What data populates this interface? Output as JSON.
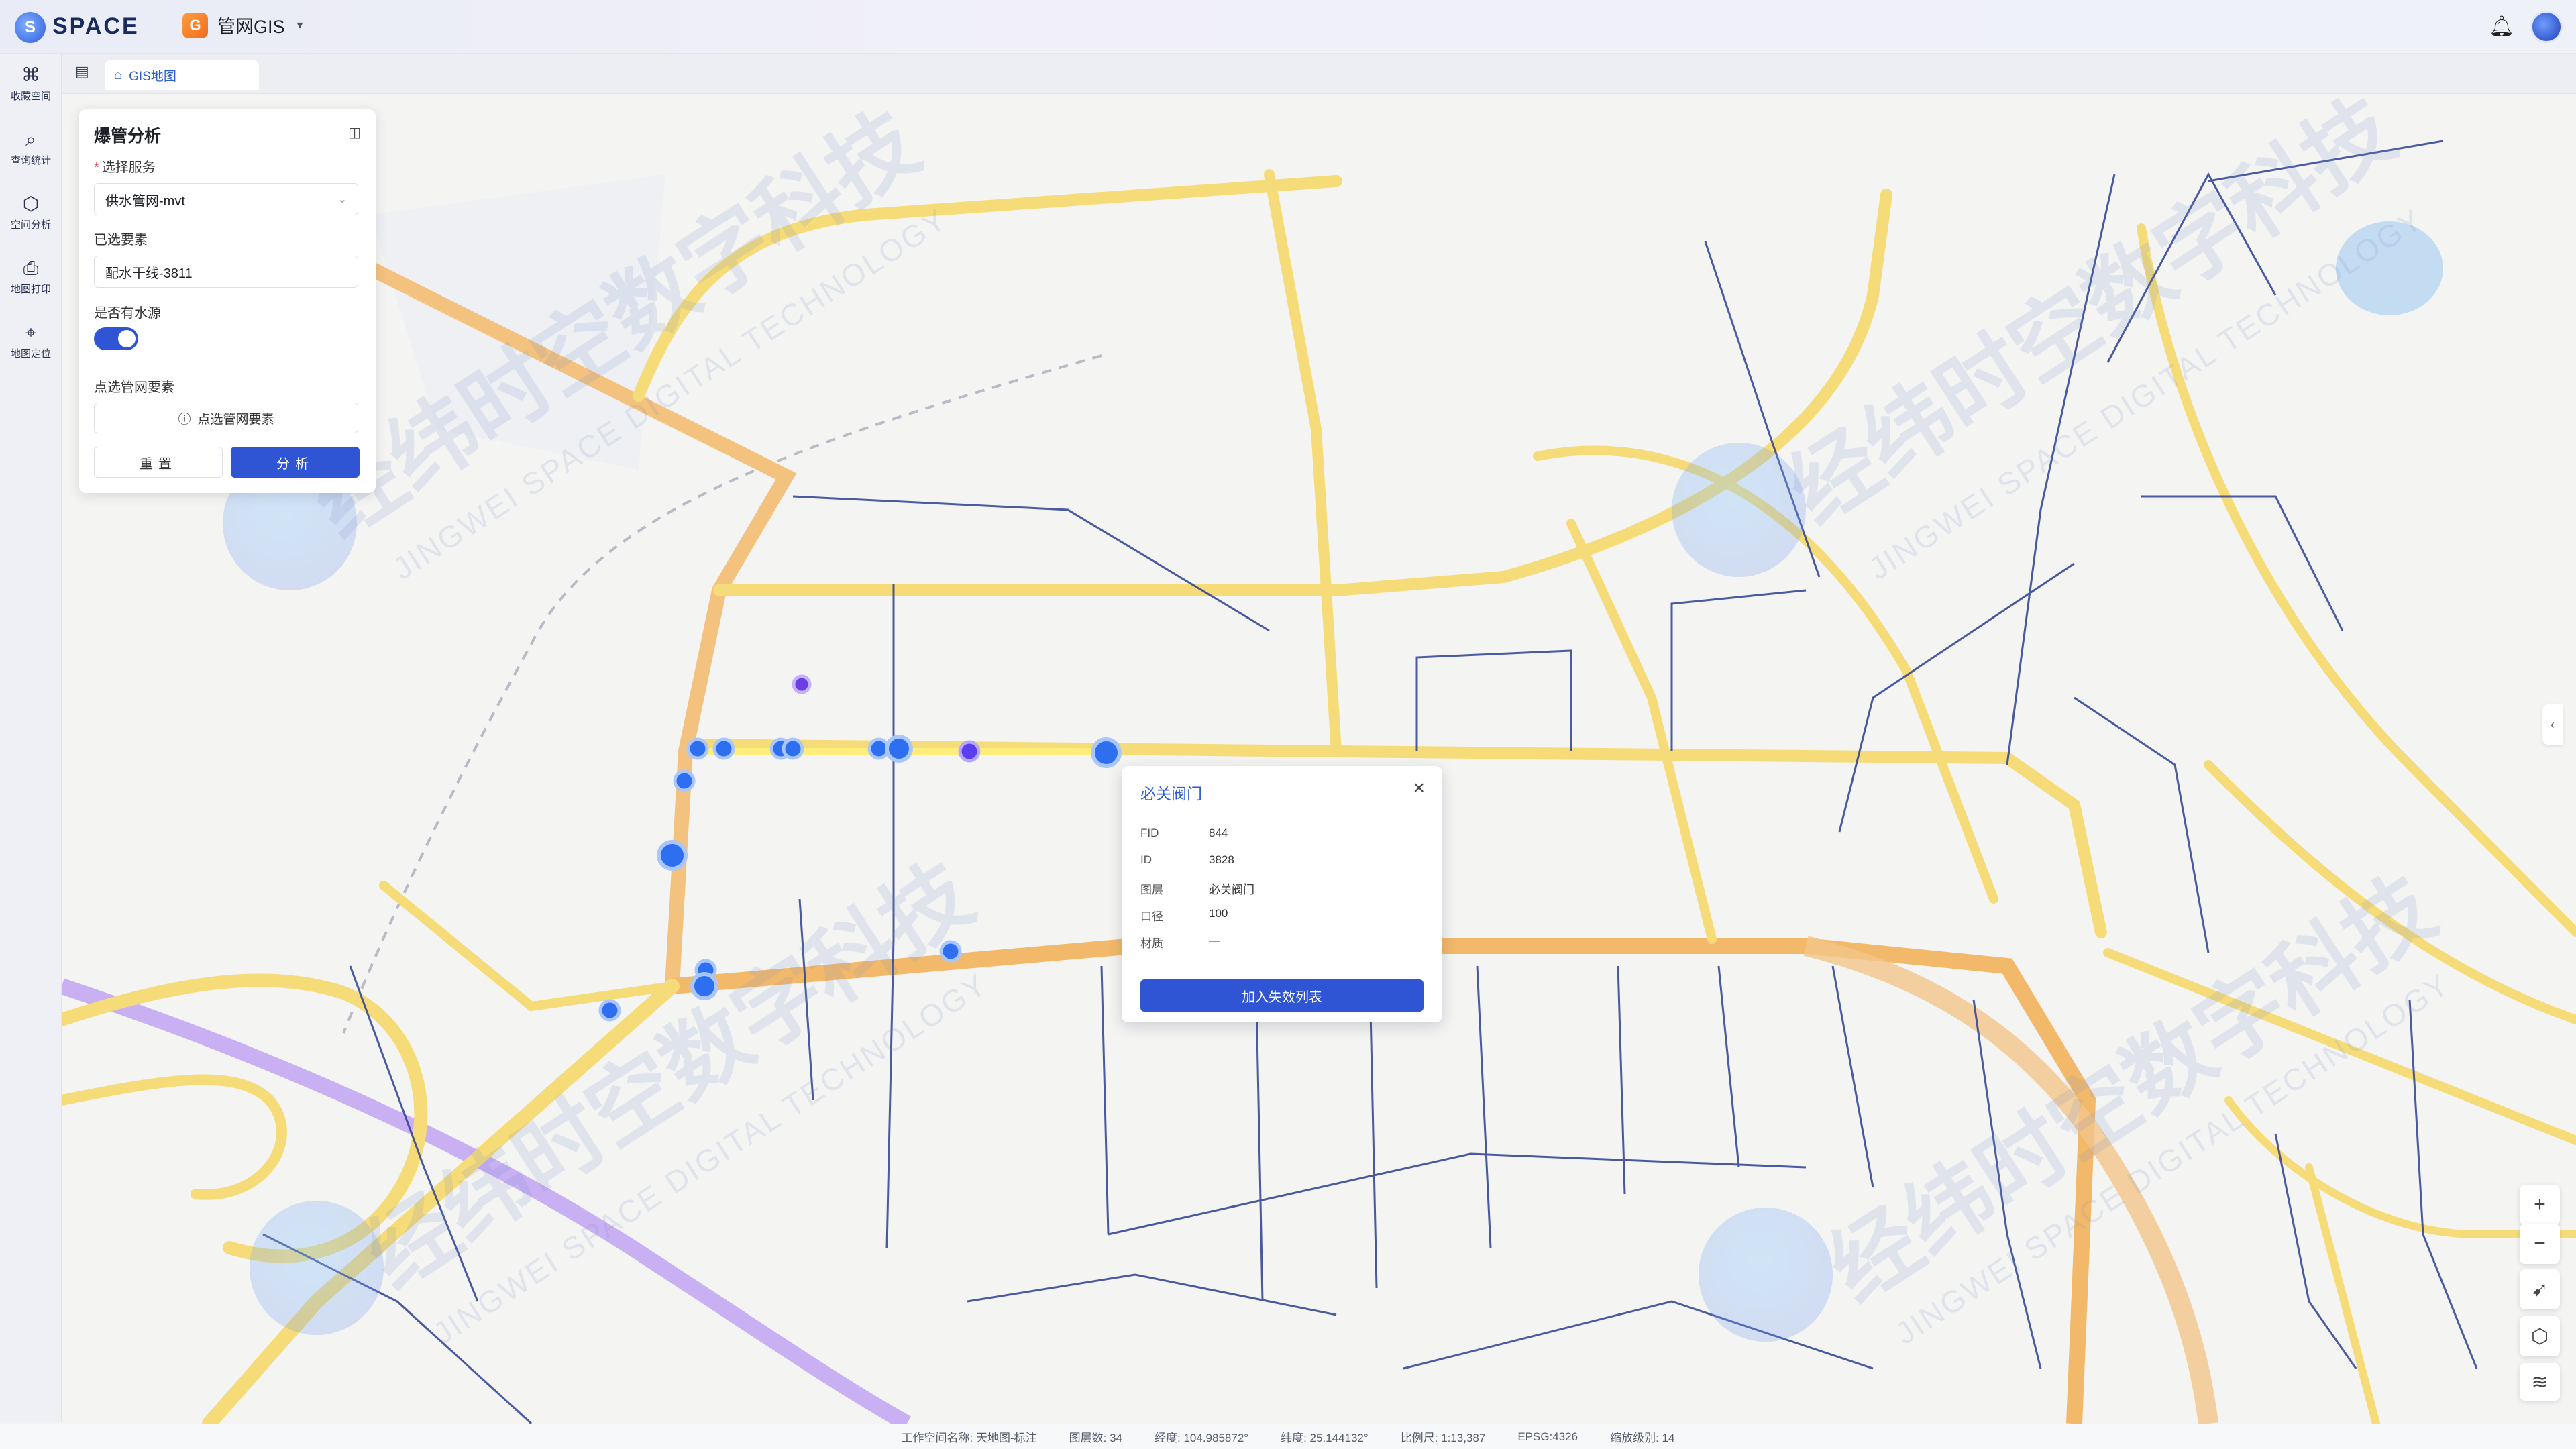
{
  "topbar": {
    "brand": "SPACE",
    "logo_glyph": "S",
    "app_name": "管网GIS",
    "app_glyph": "G"
  },
  "sidenav": [
    {
      "icon": "map-collection-icon",
      "label": "收藏空间"
    },
    {
      "icon": "query-stats-icon",
      "label": "查询统计"
    },
    {
      "icon": "spatial-analysis-icon",
      "label": "空间分析"
    },
    {
      "icon": "print-icon",
      "label": "地图打印"
    },
    {
      "icon": "location-icon",
      "label": "地图定位"
    }
  ],
  "tabs": [
    {
      "label": "GIS地图"
    }
  ],
  "panel": {
    "title": "爆管分析",
    "service_label": "选择服务",
    "service_value": "供水管网-mvt",
    "selected_label": "已选要素",
    "selected_value": "配水干线-3811",
    "water_source_label": "是否有水源",
    "water_source_on": true,
    "pick_label": "点选管网要素",
    "pick_button": "点选管网要素",
    "reset_button": "重置",
    "analyze_button": "分析"
  },
  "popup": {
    "title": "必关阀门",
    "rows": [
      {
        "key": "FID",
        "value": "844"
      },
      {
        "key": "ID",
        "value": "3828"
      },
      {
        "key": "图层",
        "value": "必关阀门"
      },
      {
        "key": "口径",
        "value": "100"
      },
      {
        "key": "材质",
        "value": "—"
      }
    ],
    "action_button": "加入失效列表"
  },
  "watermark": {
    "cn": "经纬时空数字科技",
    "en": "JINGWEI SPACE DIGITAL TECHNOLOGY"
  },
  "statusbar": {
    "workspace": "工作空间名称: 天地图-标注",
    "layers": "图层数: 34",
    "lon": "经度: 104.985872°",
    "lat": "纬度: 25.144132°",
    "scale": "比例尺: 1:13,387",
    "crs": "EPSG:4326",
    "zoom": "缩放级别: 14"
  },
  "colors": {
    "accent": "#2f55d4",
    "road_yellow": "#f6dc79",
    "road_orange": "#f3b96a",
    "rail_purple": "#c4a4ef",
    "pipe_blue": "#2b3f92"
  }
}
